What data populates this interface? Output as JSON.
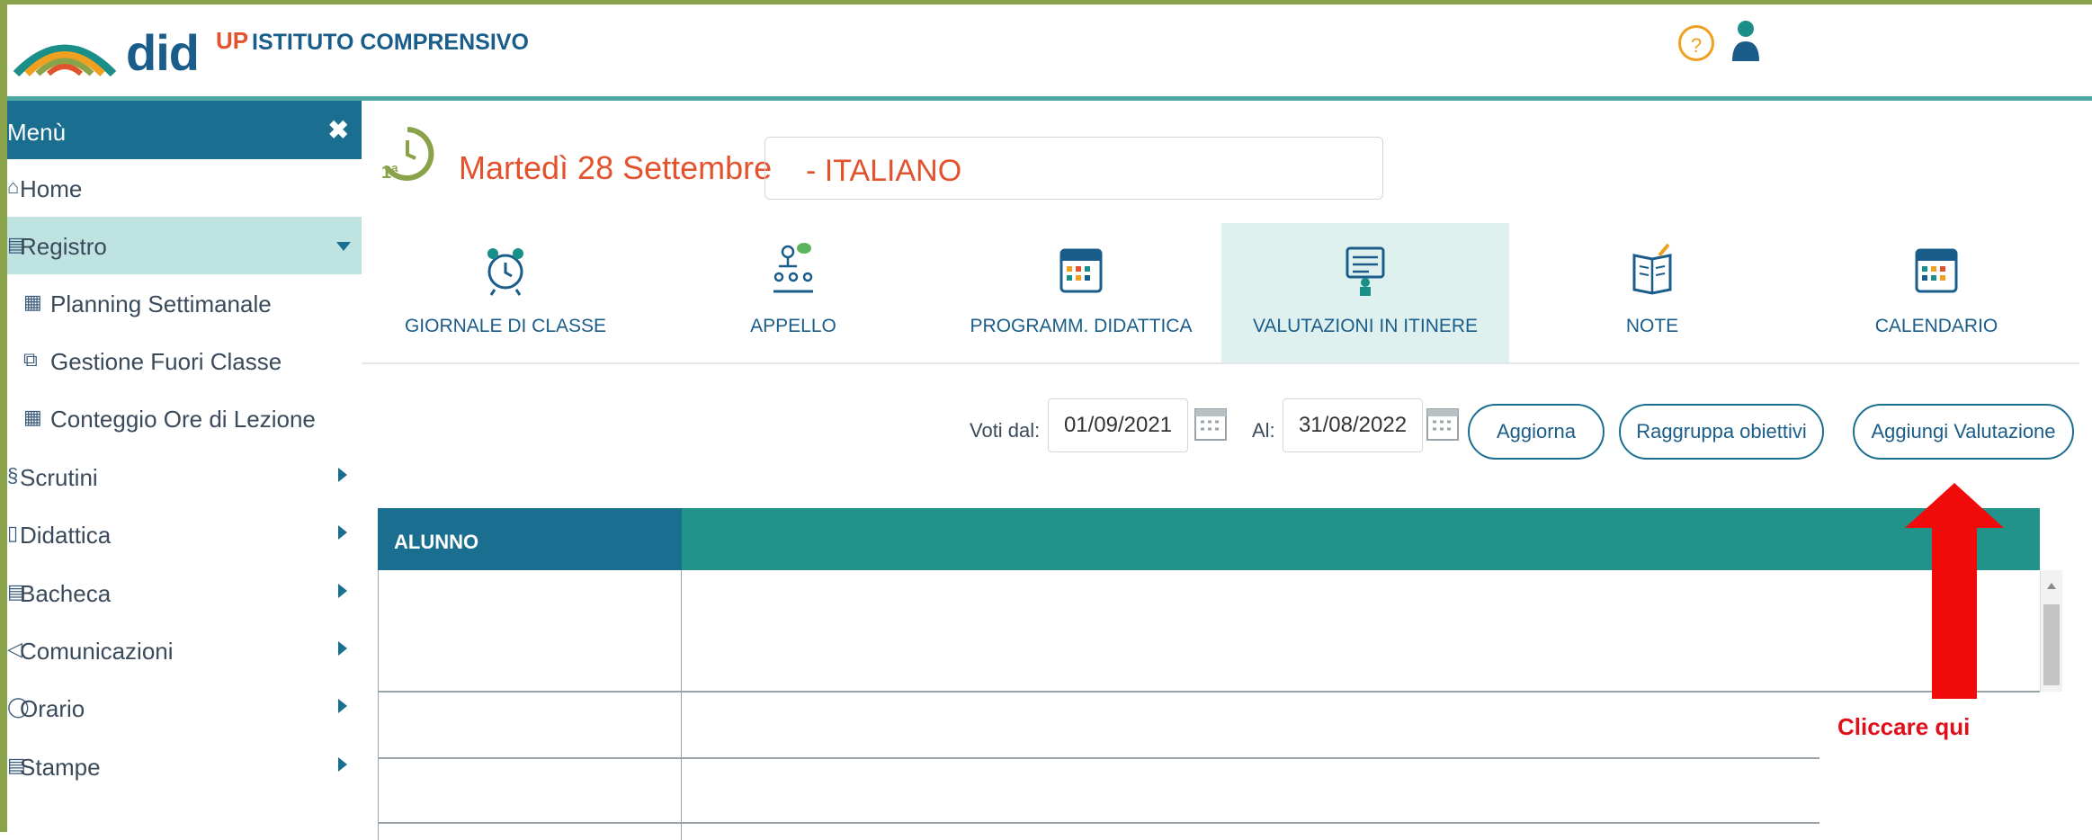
{
  "header": {
    "logo_text": "did",
    "logo_sup": "UP",
    "school_name": "ISTITUTO COMPRENSIVO",
    "help_glyph": "?"
  },
  "sidebar": {
    "title": "Menù",
    "close_glyph": "✖",
    "items": [
      {
        "label": "Home",
        "icon": "home-icon",
        "glyph": "⌂"
      },
      {
        "label": "Registro",
        "icon": "register-icon",
        "glyph": "▤"
      },
      {
        "label": "Planning Settimanale",
        "icon": "calendar-icon",
        "glyph": "▦"
      },
      {
        "label": "Gestione Fuori Classe",
        "icon": "external-link-icon",
        "glyph": "⧉"
      },
      {
        "label": "Conteggio Ore di Lezione",
        "icon": "table-icon",
        "glyph": "▦"
      },
      {
        "label": "Scrutini",
        "icon": "scrutini-icon",
        "glyph": "§"
      },
      {
        "label": "Didattica",
        "icon": "didattica-icon",
        "glyph": "▯"
      },
      {
        "label": "Bacheca",
        "icon": "bacheca-icon",
        "glyph": "▤"
      },
      {
        "label": "Comunicazioni",
        "icon": "megaphone-icon",
        "glyph": "◁"
      },
      {
        "label": "Orario",
        "icon": "clock-icon",
        "glyph": "◯"
      },
      {
        "label": "Stampe",
        "icon": "print-icon",
        "glyph": "▤"
      }
    ]
  },
  "main": {
    "date_title": "Martedì 28 Settembre",
    "subject": "- ITALIANO",
    "tabs": [
      {
        "label": "GIORNALE DI CLASSE",
        "icon": "alarm-clock-icon"
      },
      {
        "label": "APPELLO",
        "icon": "attendance-icon"
      },
      {
        "label": "PROGRAMM. DIDATTICA",
        "icon": "calendar-grid-icon"
      },
      {
        "label": "VALUTAZIONI IN ITINERE",
        "icon": "evaluation-icon",
        "active": true
      },
      {
        "label": "NOTE",
        "icon": "notebook-icon"
      },
      {
        "label": "CALENDARIO",
        "icon": "calendar-icon"
      }
    ],
    "filter": {
      "voti_dal_label": "Voti dal:",
      "date_from": "01/09/2021",
      "al_label": "Al:",
      "date_to": "31/08/2022",
      "aggiorna": "Aggiorna",
      "raggruppa": "Raggruppa obiettivi",
      "aggiungi": "Aggiungi Valutazione"
    },
    "table": {
      "header_alunno": "ALUNNO"
    }
  },
  "annotation": {
    "text": "Cliccare qui",
    "color": "#e0101a"
  },
  "colors": {
    "primary": "#1a6e8f",
    "teal": "#21938a",
    "accent": "#e2522c",
    "frame": "#8aa34a"
  }
}
